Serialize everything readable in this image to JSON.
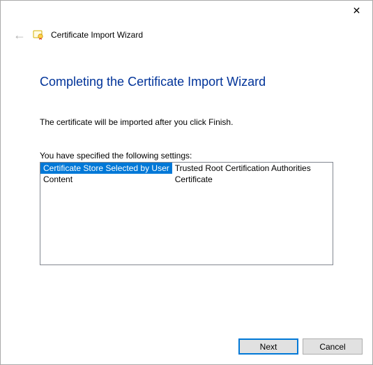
{
  "window": {
    "wizard_name": "Certificate Import Wizard"
  },
  "page": {
    "heading": "Completing the Certificate Import Wizard",
    "info": "The certificate will be imported after you click Finish.",
    "settings_label": "You have specified the following settings:"
  },
  "settings": {
    "rows": [
      {
        "label": "Certificate Store Selected by User",
        "value": "Trusted Root Certification Authorities",
        "selected": true
      },
      {
        "label": "Content",
        "value": "Certificate",
        "selected": false
      }
    ]
  },
  "buttons": {
    "next": "Next",
    "cancel": "Cancel"
  },
  "icons": {
    "close": "✕",
    "back": "←"
  }
}
